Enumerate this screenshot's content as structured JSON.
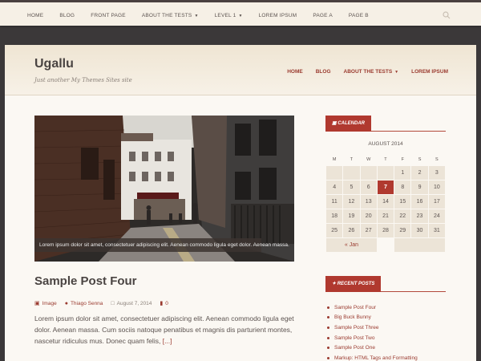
{
  "topnav": {
    "items": [
      "HOME",
      "BLOG",
      "FRONT PAGE",
      "ABOUT THE TESTS",
      "LEVEL 1",
      "LOREM IPSUM",
      "PAGE A",
      "PAGE B"
    ]
  },
  "site": {
    "title": "Ugallu",
    "description": "Just another My Themes Sites site"
  },
  "mainnav": {
    "items": [
      "HOME",
      "BLOG",
      "ABOUT THE TESTS",
      "LOREM IPSUM"
    ]
  },
  "post": {
    "caption": "Lorem ipsum dolor sit amet, consectetuer adipiscing elit. Aenean commodo ligula eget dolor. Aenean massa.",
    "title": "Sample Post Four",
    "format": "Image",
    "author": "Thiago Senna",
    "date": "August 7, 2014",
    "comments": "0",
    "excerpt": "Lorem ipsum dolor sit amet, consectetuer adipiscing elit. Aenean commodo ligula eget dolor. Aenean massa. Cum sociis natoque penatibus et magnis dis parturient montes, nascetur ridiculus mus. Donec quam felis,",
    "more": "[...]"
  },
  "calendar": {
    "widget_title": "Calendar",
    "caption": "AUGUST 2014",
    "days": [
      "M",
      "T",
      "W",
      "T",
      "F",
      "S",
      "S"
    ],
    "weeks": [
      [
        "",
        "",
        "",
        "",
        "1",
        "2",
        "3"
      ],
      [
        "4",
        "5",
        "6",
        "7",
        "8",
        "9",
        "10"
      ],
      [
        "11",
        "12",
        "13",
        "14",
        "15",
        "16",
        "17"
      ],
      [
        "18",
        "19",
        "20",
        "21",
        "22",
        "23",
        "24"
      ],
      [
        "25",
        "26",
        "27",
        "28",
        "29",
        "30",
        "31"
      ]
    ],
    "today": "7",
    "prev": "« Jan"
  },
  "recent": {
    "widget_title": "Recent Posts",
    "items": [
      "Sample Post Four",
      "Big Buck Bunny",
      "Sample Post Three",
      "Sample Post Two",
      "Sample Post One",
      "Markup: HTML Tags and Formatting"
    ]
  },
  "colors": {
    "accent": "#b0392f",
    "background": "#3b3839",
    "card": "#fbf8f3"
  }
}
